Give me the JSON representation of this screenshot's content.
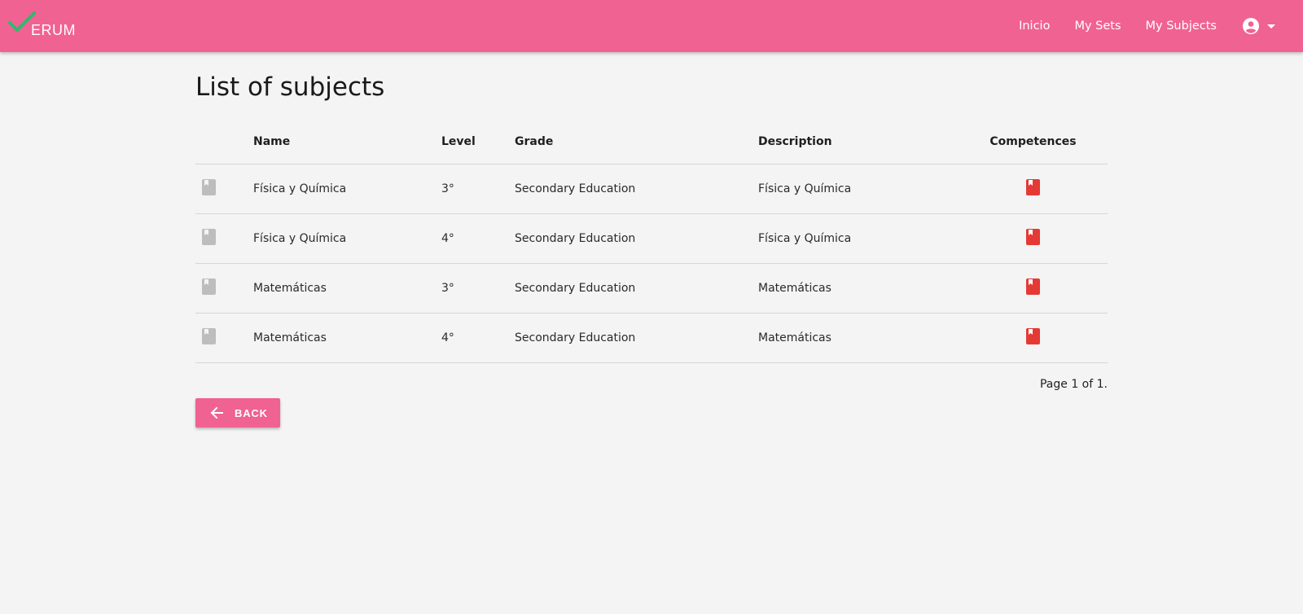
{
  "app": {
    "brand_text": "ERUM",
    "brand_accent": "#2fb96d",
    "navbar_color": "#f06292"
  },
  "nav": {
    "links": [
      "Inicio",
      "My Sets",
      "My Subjects"
    ],
    "user_icon": "account-circle-icon",
    "dropdown_icon": "caret-down-icon"
  },
  "main": {
    "title": "List of subjects",
    "columns": [
      "",
      "Name",
      "Level",
      "Grade",
      "Description",
      "Competences"
    ],
    "rows": [
      {
        "name": "Física y Química",
        "level": "3°",
        "grade": "Secondary Education",
        "description": "Física y Química"
      },
      {
        "name": "Física y Química",
        "level": "4°",
        "grade": "Secondary Education",
        "description": "Física y Química"
      },
      {
        "name": "Matemáticas",
        "level": "3°",
        "grade": "Secondary Education",
        "description": "Matemáticas"
      },
      {
        "name": "Matemáticas",
        "level": "4°",
        "grade": "Secondary Education",
        "description": "Matemáticas"
      }
    ],
    "row_icon": "book-icon",
    "row_icon_color": "#bdbdbd",
    "competence_icon": "bookmark-book-icon",
    "competence_icon_color": "#e53935",
    "pagination": "Page 1 of 1.",
    "back_label": "BACK"
  }
}
